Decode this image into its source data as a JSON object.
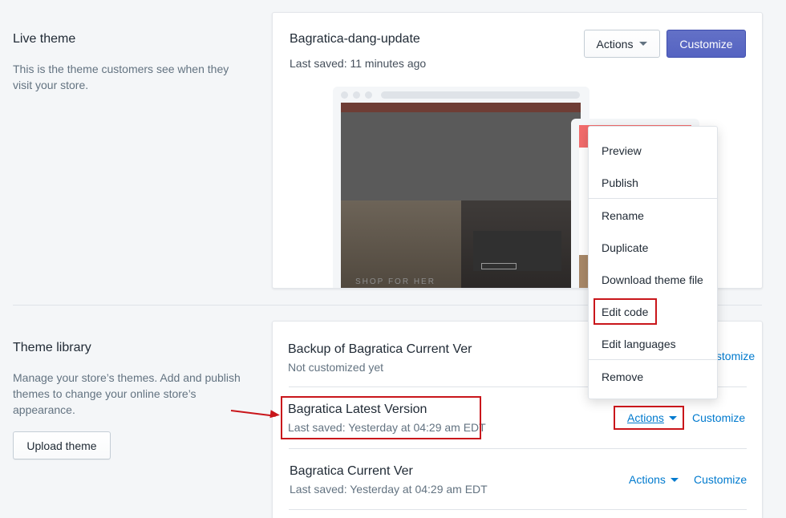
{
  "live_section": {
    "heading": "Live theme",
    "description_line1": "This is the theme customers see when they",
    "description_line2": "visit your store."
  },
  "live_card": {
    "title": "Bagratica-dang-update",
    "last_saved": "Last saved: 11 minutes ago",
    "actions_label": "Actions",
    "customize_label": "Customize",
    "preview_text": "SHOP FOR HER"
  },
  "library_section": {
    "heading": "Theme library",
    "description_line1": "Manage your store’s themes. Add and publish",
    "description_line2": "themes to change your online store’s",
    "description_line3": "appearance.",
    "upload_label": "Upload theme"
  },
  "themes": [
    {
      "title": "Backup of Bagratica Current Ver",
      "subtitle": "Not customized yet",
      "customize_label": "Customize"
    },
    {
      "title": "Bagratica Latest Version",
      "subtitle": "Last saved: Yesterday at 04:29 am EDT",
      "actions_label": "Actions",
      "customize_label": "Customize"
    },
    {
      "title": "Bagratica Current Ver",
      "subtitle": "Last saved: Yesterday at 04:29 am EDT",
      "actions_label": "Actions",
      "customize_label": "Customize"
    }
  ],
  "actions_menu": {
    "items": [
      "Preview",
      "Publish",
      "Rename",
      "Duplicate",
      "Download theme file",
      "Edit code",
      "Edit languages",
      "Remove"
    ]
  },
  "colors": {
    "primary": "#5c6ac4",
    "link": "#007ace",
    "highlight": "#c9161b"
  }
}
